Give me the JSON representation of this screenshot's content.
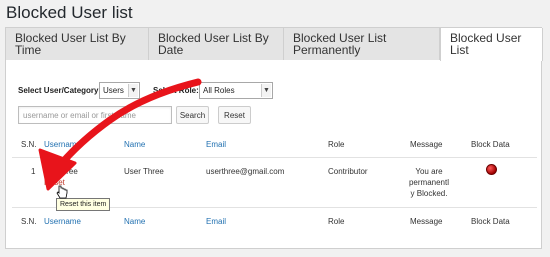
{
  "page_title": "Blocked User list",
  "tabs": [
    {
      "label": "Blocked User List By Time",
      "active": false
    },
    {
      "label": "Blocked User List By Date",
      "active": false
    },
    {
      "label": "Blocked User List Permanently",
      "active": false
    },
    {
      "label": "Blocked User List",
      "active": true
    }
  ],
  "filters": {
    "category_label": "Select User/Category:",
    "category_value": "Users",
    "role_label": "Select Role:",
    "role_value": "All Roles",
    "search_placeholder": "username or email or first name",
    "search_button": "Search",
    "reset_button": "Reset"
  },
  "table": {
    "headers": [
      "S.N.",
      "Username",
      "Name",
      "Email",
      "Role",
      "Message",
      "Block Data"
    ],
    "rows": [
      {
        "sn": "1",
        "username": "userthree",
        "reset_label": "Reset",
        "name": "User Three",
        "email": "userthree@gmail.com",
        "role": "Contributor",
        "message_lines": [
          "You are",
          "permanentl",
          "y Blocked."
        ],
        "block_indicator": "red-dot-icon"
      }
    ],
    "footer": [
      "S.N.",
      "Username",
      "Name",
      "Email",
      "Role",
      "Message",
      "Block Data"
    ]
  },
  "tooltip": "Reset this item",
  "colors": {
    "link": "#2271b1",
    "reset": "#c0392b",
    "annotation_arrow": "#e8141b"
  }
}
